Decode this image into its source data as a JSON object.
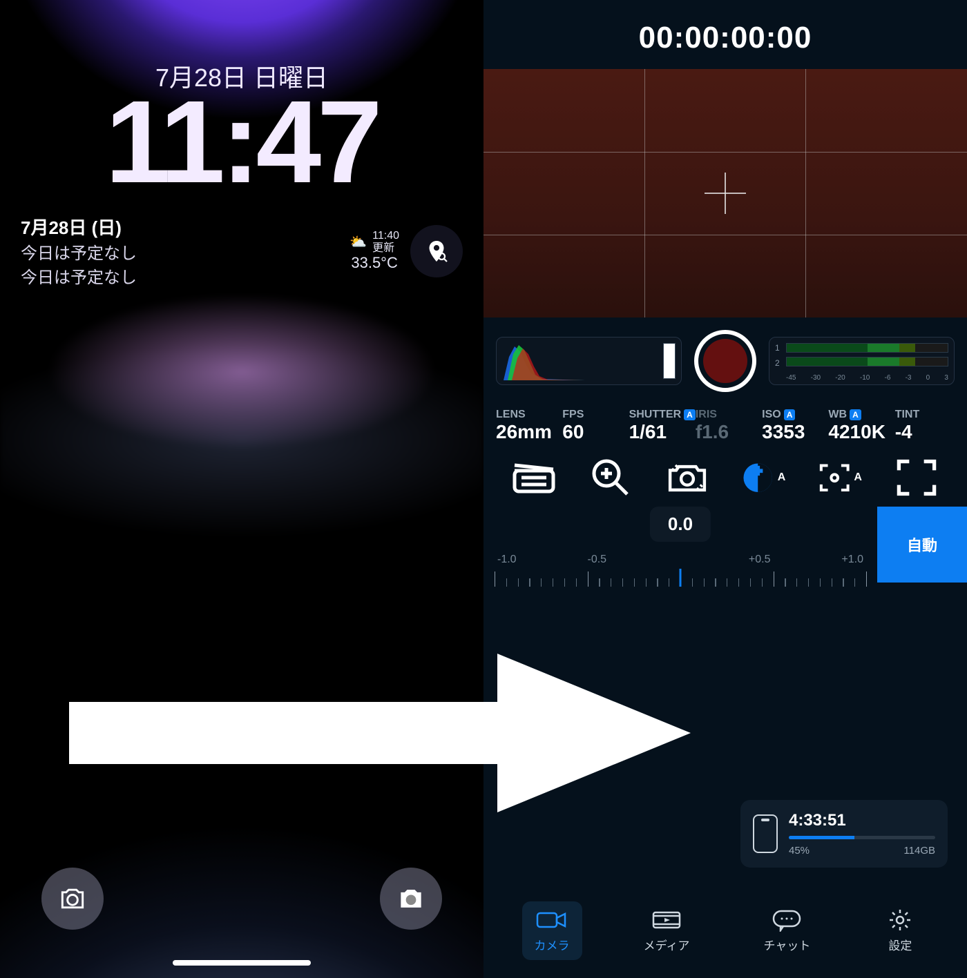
{
  "lock": {
    "date": "7月28日 日曜日",
    "time": "11:47",
    "cal": {
      "l1": "7月28日 (日)",
      "l2": "今日は予定なし",
      "l3": "今日は予定なし"
    },
    "weather": {
      "time": "11:40",
      "update": "更新",
      "temp": "33.5°C"
    }
  },
  "cam": {
    "timecode": "00:00:00:00",
    "audio_labels": [
      "-45",
      "-30",
      "-20",
      "-10",
      "-6",
      "-3",
      "0",
      "3"
    ],
    "params": {
      "lens": {
        "label": "LENS",
        "value": "26mm",
        "auto": false
      },
      "fps": {
        "label": "FPS",
        "value": "60",
        "auto": false
      },
      "shutter": {
        "label": "SHUTTER",
        "value": "1/61",
        "auto": true
      },
      "iris": {
        "label": "IRIS",
        "value": "f1.6",
        "auto": false,
        "dim": true
      },
      "iso": {
        "label": "ISO",
        "value": "3353",
        "auto": true
      },
      "wb": {
        "label": "WB",
        "value": "4210K",
        "auto": true
      },
      "tint": {
        "label": "TINT",
        "value": "-4",
        "auto": false
      }
    },
    "exposure": {
      "value": "0.0",
      "marks": [
        "-1.0",
        "-0.5",
        "",
        "+0.5",
        "+1.0"
      ],
      "auto_label": "自動"
    },
    "storage": {
      "time": "4:33:51",
      "pct": "45%",
      "size": "114GB",
      "pct_num": 45
    },
    "tabs": {
      "camera": "カメラ",
      "media": "メディア",
      "chat": "チャット",
      "settings": "設定"
    }
  }
}
